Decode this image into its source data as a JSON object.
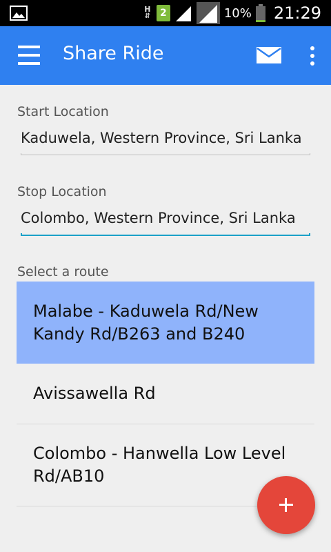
{
  "statusbar": {
    "network_h": "H",
    "sim_number": "2",
    "battery": "10%",
    "time": "21:29"
  },
  "appbar": {
    "title": "Share Ride",
    "icons": [
      "menu-icon",
      "mail-icon",
      "more-vert-icon"
    ]
  },
  "form": {
    "start_label": "Start Location",
    "start_value": "Kaduwela, Western Province, Sri Lanka",
    "stop_label": "Stop Location",
    "stop_value": "Colombo, Western Province, Sri Lanka",
    "routes_label": "Select a route"
  },
  "routes": [
    {
      "label": "Malabe - Kaduwela Rd/New Kandy Rd/B263 and B240",
      "selected": true
    },
    {
      "label": "Avissawella Rd",
      "selected": false
    },
    {
      "label": "Colombo - Hanwella Low Level Rd/AB10",
      "selected": false
    }
  ],
  "colors": {
    "appbar": "#2f80f0",
    "selected_route": "#8fb3fb",
    "fab": "#e4463a",
    "focused_underline": "#1aa0c8"
  }
}
